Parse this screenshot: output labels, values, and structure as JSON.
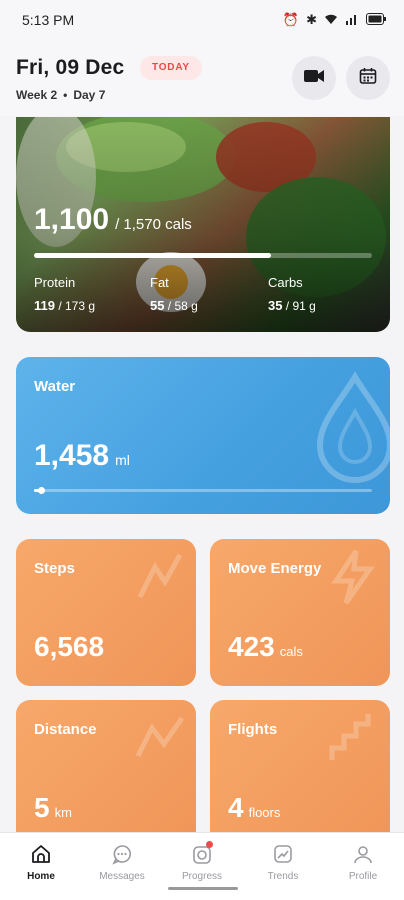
{
  "status_bar": {
    "time": "5:13 PM"
  },
  "header": {
    "date": "Fri, 09 Dec",
    "today_badge": "TODAY",
    "week": "Week 2",
    "separator": "•",
    "day": "Day 7"
  },
  "calories": {
    "consumed": "1,100",
    "goal": "/ 1,570 cals",
    "progress": 0.7,
    "macros": [
      {
        "label": "Protein",
        "value": "119",
        "goal": " / 173 g"
      },
      {
        "label": "Fat",
        "value": "55",
        "goal": " / 58 g"
      },
      {
        "label": "Carbs",
        "value": "35",
        "goal": " / 91 g"
      }
    ]
  },
  "water": {
    "title": "Water",
    "value": "1,458",
    "unit": "ml",
    "progress": 0.02
  },
  "tiles": [
    {
      "title": "Steps",
      "value": "6,568",
      "unit": ""
    },
    {
      "title": "Move Energy",
      "value": "423",
      "unit": "cals"
    },
    {
      "title": "Distance",
      "value": "5",
      "unit": "km"
    },
    {
      "title": "Flights",
      "value": "4",
      "unit": "floors"
    }
  ],
  "tabbar": {
    "items": [
      {
        "label": "Home",
        "icon": "home-icon",
        "active": true
      },
      {
        "label": "Messages",
        "icon": "messages-icon",
        "active": false
      },
      {
        "label": "Progress",
        "icon": "progress-icon",
        "active": false
      },
      {
        "label": "Trends",
        "icon": "trends-icon",
        "active": false
      },
      {
        "label": "Profile",
        "icon": "profile-icon",
        "active": false
      }
    ]
  },
  "colors": {
    "accent_red": "#e84a4a",
    "water": "#45a0e0",
    "activity": "#f09558"
  }
}
